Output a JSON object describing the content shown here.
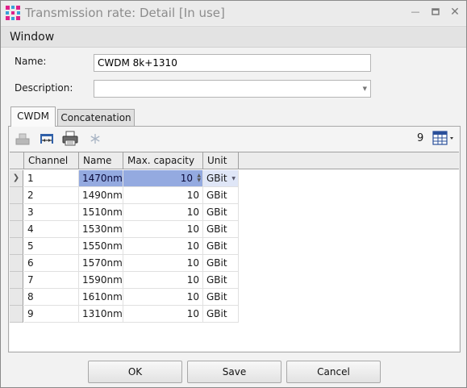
{
  "window": {
    "title": "Transmission rate: Detail [In use]",
    "minimize_icon": "minimize-icon",
    "maximize_icon": "maximize-icon",
    "close_icon": "close-icon"
  },
  "section": {
    "header": "Window"
  },
  "form": {
    "name_label": "Name:",
    "name_value": "CWDM 8k+1310",
    "description_label": "Description:",
    "description_value": ""
  },
  "tabs": [
    {
      "label": "CWDM",
      "active": true
    },
    {
      "label": "Concatenation",
      "active": false
    }
  ],
  "toolbar": {
    "icons": [
      "add-channel-icon",
      "measure-icon",
      "print-icon",
      "freeze-icon"
    ],
    "row_count": "9",
    "layout_icon": "grid-layout-icon"
  },
  "grid": {
    "columns": [
      "Channel",
      "Name",
      "Max. capacity",
      "Unit"
    ],
    "rows": [
      {
        "channel": "1",
        "name": "1470nm",
        "capacity": "10",
        "unit": "GBit"
      },
      {
        "channel": "2",
        "name": "1490nm",
        "capacity": "10",
        "unit": "GBit"
      },
      {
        "channel": "3",
        "name": "1510nm",
        "capacity": "10",
        "unit": "GBit"
      },
      {
        "channel": "4",
        "name": "1530nm",
        "capacity": "10",
        "unit": "GBit"
      },
      {
        "channel": "5",
        "name": "1550nm",
        "capacity": "10",
        "unit": "GBit"
      },
      {
        "channel": "6",
        "name": "1570nm",
        "capacity": "10",
        "unit": "GBit"
      },
      {
        "channel": "7",
        "name": "1590nm",
        "capacity": "10",
        "unit": "GBit"
      },
      {
        "channel": "8",
        "name": "1610nm",
        "capacity": "10",
        "unit": "GBit"
      },
      {
        "channel": "9",
        "name": "1310nm",
        "capacity": "10",
        "unit": "GBit"
      }
    ],
    "selected_row": 0,
    "selection_color": "#94aae0"
  },
  "buttons": {
    "ok": "OK",
    "save": "Save",
    "cancel": "Cancel"
  }
}
